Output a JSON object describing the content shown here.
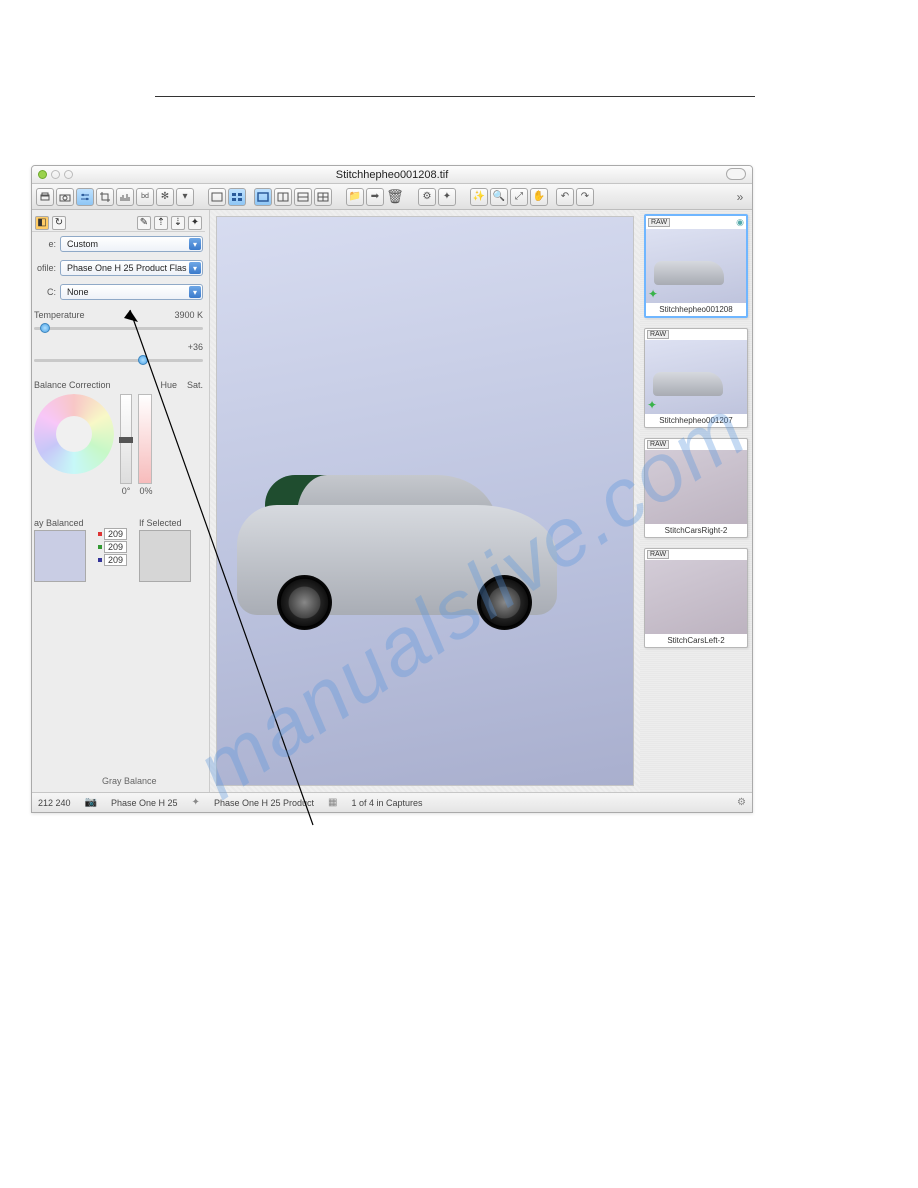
{
  "watermark_text": "manualslive.com",
  "window": {
    "title": "Stitchhepheo001208.tif"
  },
  "left": {
    "row_e": {
      "label": "e:",
      "value": "Custom"
    },
    "row_profile": {
      "label": "ofile:",
      "value": "Phase One H 25 Product Flas"
    },
    "row_c": {
      "label": "C:",
      "value": "None"
    },
    "temperature": {
      "label": "Temperature",
      "value": "3900 K"
    },
    "tint": {
      "value": "+36"
    },
    "balance_correction": "Balance Correction",
    "hue_label": "Hue",
    "sat_label": "Sat.",
    "hue_value": "0°",
    "sat_value": "0%",
    "gray_balanced": "ay Balanced",
    "if_selected": "If Selected",
    "rgb": {
      "r": "209",
      "g": "209",
      "b": "209"
    },
    "gray_balance_footer": "Gray Balance"
  },
  "thumbs": [
    {
      "badge": "RAW",
      "name": "Stitchhepheo001208",
      "selected": true,
      "star": true,
      "eye": true,
      "blank": false
    },
    {
      "badge": "RAW",
      "name": "Stitchhepheo001207",
      "selected": false,
      "star": true,
      "eye": false,
      "blank": false
    },
    {
      "badge": "RAW",
      "name": "StitchCarsRight-2",
      "selected": false,
      "star": false,
      "eye": false,
      "blank": true
    },
    {
      "badge": "RAW",
      "name": "StitchCarsLeft-2",
      "selected": false,
      "star": false,
      "eye": false,
      "blank": true
    }
  ],
  "status": {
    "dims": "212   240",
    "camera": "Phase One H 25",
    "profile": "Phase One H 25 Product",
    "captures": "1 of 4 in Captures"
  }
}
